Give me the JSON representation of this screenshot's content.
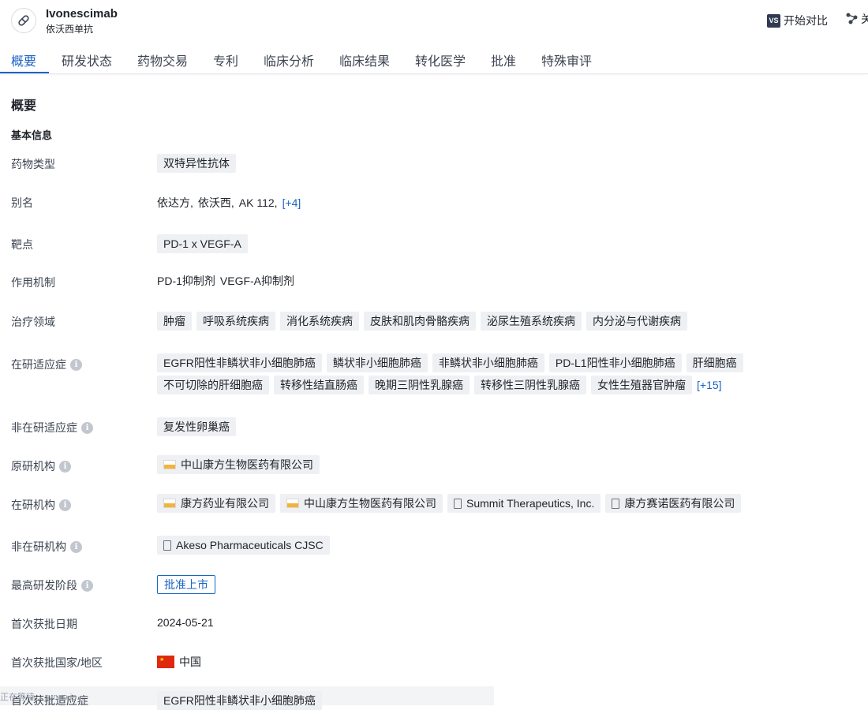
{
  "header": {
    "drug_name": "Ivonescimab",
    "drug_name_cn": "依沃西单抗",
    "vs_badge": "VS",
    "compare_label": "开始对比",
    "share_label": "关"
  },
  "tabs": [
    {
      "label": "概要"
    },
    {
      "label": "研发状态"
    },
    {
      "label": "药物交易"
    },
    {
      "label": "专利"
    },
    {
      "label": "临床分析"
    },
    {
      "label": "临床结果"
    },
    {
      "label": "转化医学"
    },
    {
      "label": "批准"
    },
    {
      "label": "特殊审评"
    }
  ],
  "section_title": "概要",
  "sub_title": "基本信息",
  "rows": {
    "drug_type": {
      "label": "药物类型",
      "chips": [
        "双特异性抗体"
      ]
    },
    "alias": {
      "label": "别名",
      "values": [
        "依达方,",
        "依沃西,",
        "AK 112,"
      ],
      "more": "[+4]"
    },
    "target": {
      "label": "靶点",
      "chips": [
        "PD-1 x VEGF-A"
      ]
    },
    "mechanism": {
      "label": "作用机制",
      "values": [
        "PD-1抑制剂",
        "VEGF-A抑制剂"
      ]
    },
    "therapeutic_area": {
      "label": "治疗领域",
      "chips": [
        "肿瘤",
        "呼吸系统疾病",
        "消化系统疾病",
        "皮肤和肌肉骨骼疾病",
        "泌尿生殖系统疾病",
        "内分泌与代谢疾病"
      ]
    },
    "active_indications": {
      "label": "在研适应症",
      "chips": [
        "EGFR阳性非鳞状非小细胞肺癌",
        "鳞状非小细胞肺癌",
        "非鳞状非小细胞肺癌",
        "PD-L1阳性非小细胞肺癌",
        "肝细胞癌",
        "不可切除的肝细胞癌",
        "转移性结直肠癌",
        "晚期三阴性乳腺癌",
        "转移性三阴性乳腺癌",
        "女性生殖器官肿瘤"
      ],
      "more": "[+15]"
    },
    "inactive_indications": {
      "label": "非在研适应症",
      "chips": [
        "复发性卵巢癌"
      ]
    },
    "originator": {
      "label": "原研机构",
      "orgs": [
        "中山康方生物医药有限公司"
      ]
    },
    "active_orgs": {
      "label": "在研机构",
      "orgs": [
        "康方药业有限公司",
        "中山康方生物医药有限公司",
        "Summit Therapeutics, Inc.",
        "康方赛诺医药有限公司"
      ]
    },
    "inactive_orgs": {
      "label": "非在研机构",
      "orgs": [
        "Akeso Pharmaceuticals CJSC"
      ]
    },
    "highest_phase": {
      "label": "最高研发阶段",
      "value": "批准上市"
    },
    "first_approval_date": {
      "label": "首次获批日期",
      "value": "2024-05-21"
    },
    "first_approval_country": {
      "label": "首次获批国家/地区",
      "value": "中国"
    },
    "first_approval_indication": {
      "label": "首次获批适应症",
      "chips": [
        "EGFR阳性非鳞状非小细胞肺癌"
      ]
    }
  },
  "footer": {
    "text": "正在等待 ...synap.io..."
  }
}
